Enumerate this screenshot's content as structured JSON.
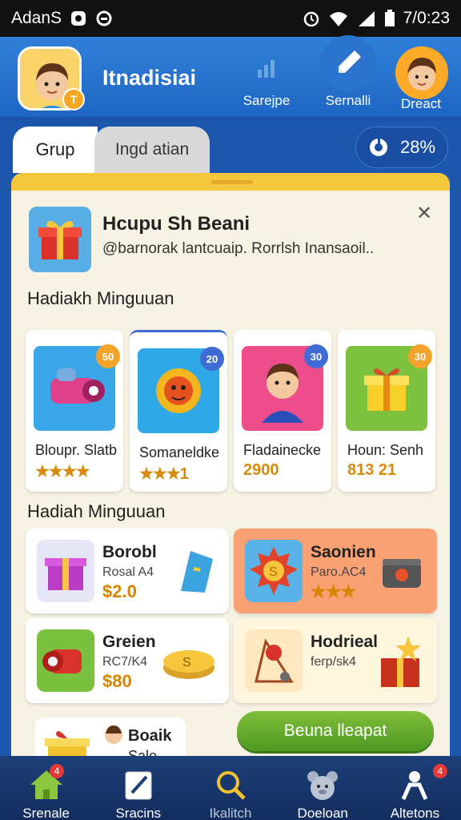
{
  "status_bar": {
    "carrier": "AdanS",
    "time": "7/0:23"
  },
  "header": {
    "app_title": "Itnadisiai",
    "avatar_badge": "T",
    "buttons": [
      {
        "label": "Sarejpe",
        "icon": "signal-icon"
      },
      {
        "label": "Sernalli",
        "icon": "pen-icon"
      }
    ],
    "profile_label": "Dreact"
  },
  "tabs": [
    {
      "label": "Grup"
    },
    {
      "label": "Ingd atian"
    }
  ],
  "progress_pill": {
    "value": "28%",
    "fraction": 0.28
  },
  "notification": {
    "title": "Hcupu Sh Beani",
    "text": "@barnorak lantcuaip. Rorrlsh Inansaoil.."
  },
  "section1": {
    "title": "Hadiakh Minguuan"
  },
  "cards": [
    {
      "name": "Bloupr. Slatb",
      "value": "★★★★",
      "badge": "50",
      "badge_color": "#f4a32a"
    },
    {
      "name": "Somaneldke",
      "value": "★★★1",
      "badge": "20",
      "badge_color": "#3f6bd4"
    },
    {
      "name": "Fladainecke",
      "value": "2900",
      "badge": "30",
      "badge_color": "#3f6bd4"
    },
    {
      "name": "Houn: Senh",
      "value": "813 21",
      "badge": "30",
      "badge_color": "#f4a32a"
    }
  ],
  "section2": {
    "title": "Hadiah Minguuan"
  },
  "offers": [
    {
      "title": "Borobl",
      "sub": "Rosal A4",
      "price": "$2.0",
      "bg": "#ffffff"
    },
    {
      "title": "Saonien",
      "sub": "Paro.AC4",
      "price": "★★★",
      "bg": "#f9a173"
    },
    {
      "title": "Greien",
      "sub": "RC7/K4",
      "price": "$80",
      "bg": "#ffffff"
    },
    {
      "title": "Hodrieal",
      "sub": "ferp/sk4",
      "price": "",
      "bg": "#fff6de"
    }
  ],
  "mini_card": {
    "title": "Boaik",
    "sub": "Sale"
  },
  "cta": {
    "label": "Beuna lleapat"
  },
  "nav": [
    {
      "label": "Srenale",
      "icon": "home-icon",
      "badge": "4"
    },
    {
      "label": "Sracins",
      "icon": "edit-icon",
      "badge": ""
    },
    {
      "label": "Ikalitch",
      "icon": "search-icon",
      "badge": ""
    },
    {
      "label": "Doeloan",
      "icon": "bear-icon",
      "badge": ""
    },
    {
      "label": "Altetons",
      "icon": "person-icon",
      "badge": "4"
    }
  ]
}
